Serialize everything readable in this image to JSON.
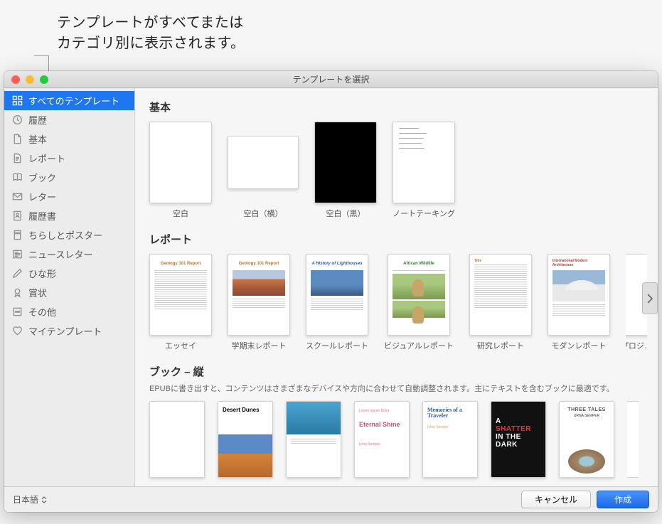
{
  "callout": {
    "line1": "テンプレートがすべてまたは",
    "line2": "カテゴリ別に表示されます。"
  },
  "window": {
    "title": "テンプレートを選択"
  },
  "sidebar": {
    "items": [
      {
        "label": "すべてのテンプレート",
        "icon": "grid",
        "selected": true
      },
      {
        "label": "履歴",
        "icon": "clock",
        "selected": false
      },
      {
        "label": "基本",
        "icon": "doc",
        "selected": false
      },
      {
        "label": "レポート",
        "icon": "doclines",
        "selected": false
      },
      {
        "label": "ブック",
        "icon": "book",
        "selected": false
      },
      {
        "label": "レター",
        "icon": "envelope",
        "selected": false
      },
      {
        "label": "履歴書",
        "icon": "person",
        "selected": false
      },
      {
        "label": "ちらしとポスター",
        "icon": "poster",
        "selected": false
      },
      {
        "label": "ニュースレター",
        "icon": "news",
        "selected": false
      },
      {
        "label": "ひな形",
        "icon": "pencil",
        "selected": false
      },
      {
        "label": "賞状",
        "icon": "ribbon",
        "selected": false
      },
      {
        "label": "その他",
        "icon": "more",
        "selected": false
      },
      {
        "label": "マイテンプレート",
        "icon": "heart",
        "selected": false
      }
    ]
  },
  "sections": {
    "basic": {
      "title": "基本",
      "items": [
        {
          "label": "空白"
        },
        {
          "label": "空白（横）"
        },
        {
          "label": "空白（黒）"
        },
        {
          "label": "ノートテーキング"
        }
      ]
    },
    "report": {
      "title": "レポート",
      "items": [
        {
          "label": "エッセイ",
          "heading": "Geology 101 Report"
        },
        {
          "label": "学期末レポート",
          "heading": "Geology 101 Report"
        },
        {
          "label": "スクールレポート",
          "heading": "A History of Lighthouses"
        },
        {
          "label": "ビジュアルレポート",
          "heading": "African Wildlife"
        },
        {
          "label": "研究レポート",
          "heading": ""
        },
        {
          "label": "モダンレポート",
          "heading": "International Modern Architecture"
        },
        {
          "label": "プロジ…",
          "heading": ""
        }
      ]
    },
    "book": {
      "title": "ブック – 縦",
      "desc": "EPUBに書き出すと、コンテンツはさまざまなデバイスや方向に合わせて自動調整されます。主にテキストを含むブックに最適です。",
      "items": [
        {
          "title": "",
          "sub": ""
        },
        {
          "title": "Desert Dunes",
          "sub": ""
        },
        {
          "title": "",
          "sub": ""
        },
        {
          "title": "Eternal Shine",
          "sub": "Urna Semper",
          "over": "Lorem Ipsum Dolor"
        },
        {
          "title": "Memories of a Traveler",
          "sub": "Urna Semper"
        },
        {
          "title": "A SHATTER IN THE DARK",
          "sub": ""
        },
        {
          "title": "THREE TALES",
          "sub": "URNA SEMPER"
        },
        {
          "title": "",
          "sub": ""
        }
      ]
    }
  },
  "footer": {
    "language": "日本語",
    "cancel": "キャンセル",
    "create": "作成"
  }
}
